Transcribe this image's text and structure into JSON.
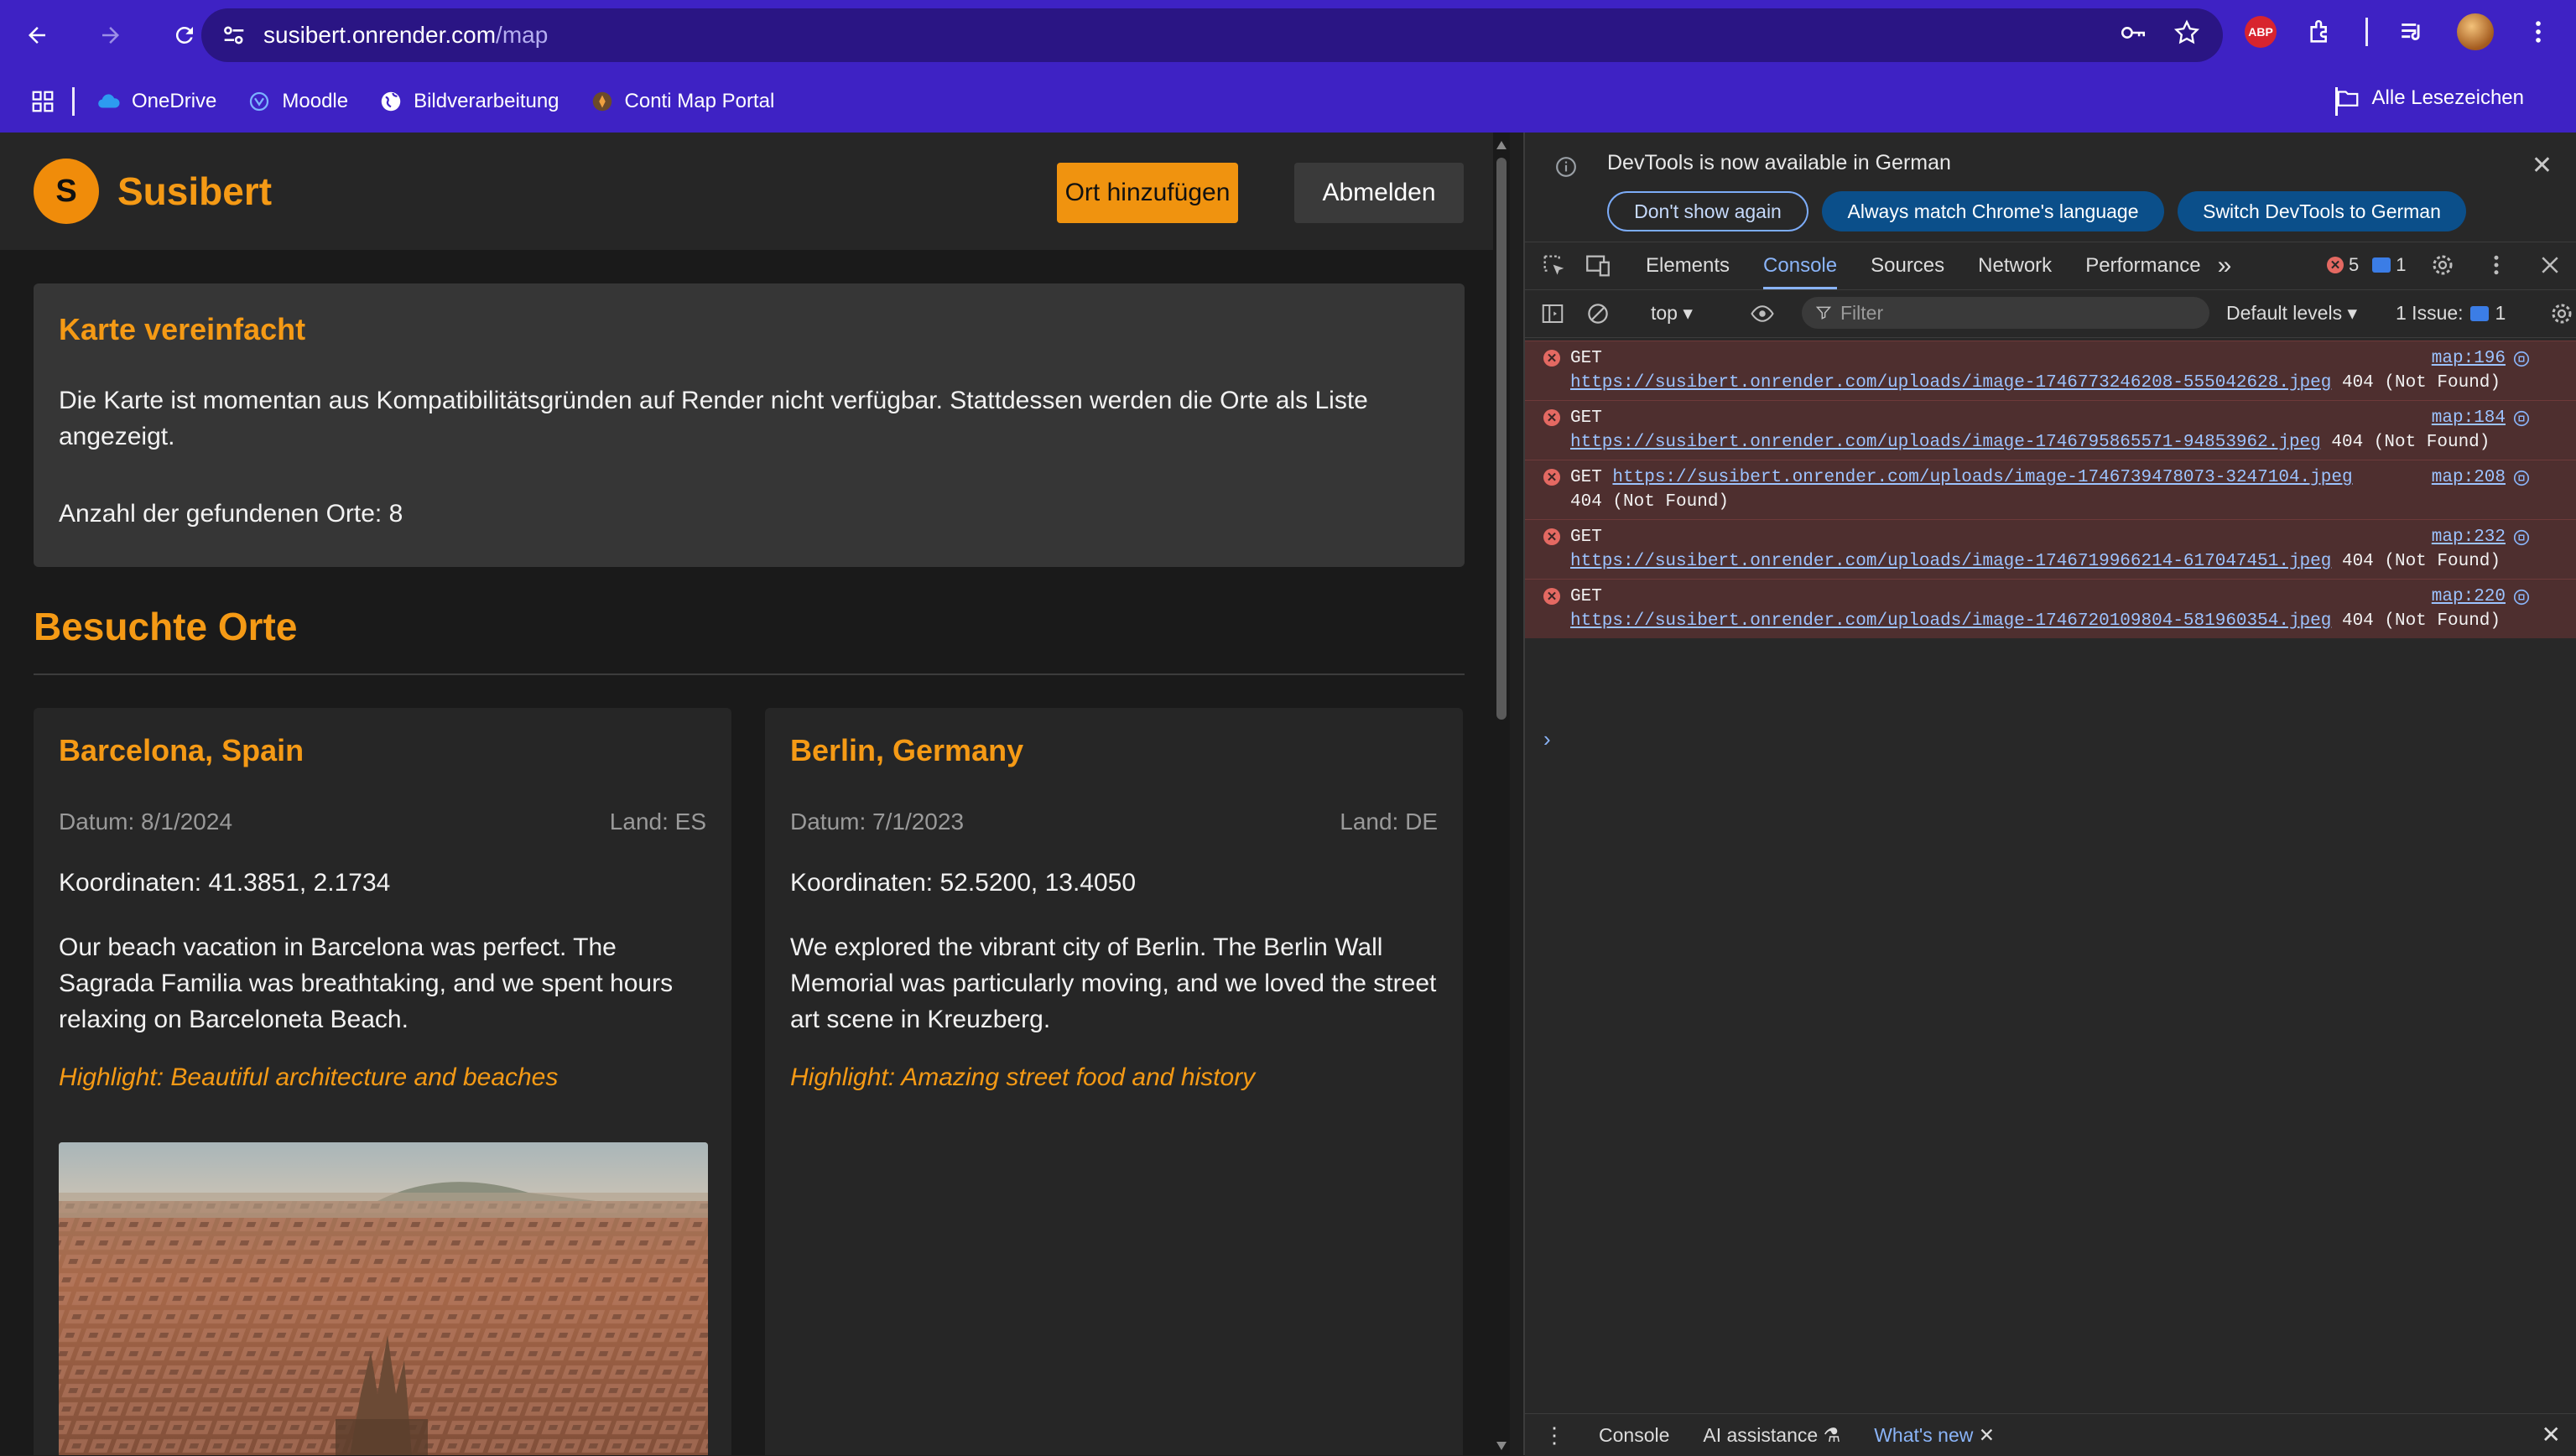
{
  "browser": {
    "url_host": "susibert.onrender.com",
    "url_path": "/map",
    "bookmarks": [
      {
        "label": "OneDrive"
      },
      {
        "label": "Moodle"
      },
      {
        "label": "Bildverarbeitung"
      },
      {
        "label": "Conti Map Portal"
      }
    ],
    "all_bookmarks": "Alle Lesezeichen",
    "abp_label": "ABP"
  },
  "app": {
    "logo_letter": "S",
    "brand": "Susibert",
    "add_button": "Ort hinzufügen",
    "logout_button": "Abmelden",
    "notice": {
      "title": "Karte vereinfacht",
      "message": "Die Karte ist momentan aus Kompatibilitätsgründen auf Render nicht verfügbar. Stattdessen werden die Orte als Liste angezeigt.",
      "count": "Anzahl der gefundenen Orte: 8"
    },
    "section_title": "Besuchte Orte",
    "cards": [
      {
        "title": "Barcelona, Spain",
        "date": "Datum: 8/1/2024",
        "land": "Land: ES",
        "coords": "Koordinaten: 41.3851, 2.1734",
        "description": "Our beach vacation in Barcelona was perfect. The Sagrada Familia was breathtaking, and we spent hours relaxing on Barceloneta Beach.",
        "highlight": "Highlight: Beautiful architecture and beaches"
      },
      {
        "title": "Berlin, Germany",
        "date": "Datum: 7/1/2023",
        "land": "Land: DE",
        "coords": "Koordinaten: 52.5200, 13.4050",
        "description": "We explored the vibrant city of Berlin. The Berlin Wall Memorial was particularly moving, and we loved the street art scene in Kreuzberg.",
        "highlight": "Highlight: Amazing street food and history"
      }
    ]
  },
  "devtools": {
    "info_text": "DevTools is now available in German",
    "btn_dont_show": "Don't show again",
    "btn_match": "Always match Chrome's language",
    "btn_switch": "Switch DevTools to German",
    "tabs": [
      "Elements",
      "Console",
      "Sources",
      "Network",
      "Performance"
    ],
    "active_tab": "Console",
    "more_tabs": "»",
    "error_count": "5",
    "message_count": "1",
    "context": "top ▾",
    "filter_placeholder": "Filter",
    "levels": "Default levels ▾",
    "issues_label": "1 Issue:",
    "issues_count": "1",
    "errors": [
      {
        "method": "GET",
        "url": "https://susibert.onrender.com/uploads/image-1746773246208-555042628.jpeg",
        "status": "404 (Not Found)",
        "source": "map:196"
      },
      {
        "method": "GET",
        "url": "https://susibert.onrender.com/uploads/image-1746795865571-94853962.jpeg",
        "status": "404 (Not Found)",
        "source": "map:184"
      },
      {
        "method": "GET",
        "url": "https://susibert.onrender.com/uploads/image-1746739478073-3247104.jpeg",
        "status": "404 (Not Found)",
        "source": "map:208"
      },
      {
        "method": "GET",
        "url": "https://susibert.onrender.com/uploads/image-1746719966214-617047451.jpeg",
        "status": "404 (Not Found)",
        "source": "map:232"
      },
      {
        "method": "GET",
        "url": "https://susibert.onrender.com/uploads/image-1746720109804-581960354.jpeg",
        "status": "404 (Not Found)",
        "source": "map:220"
      }
    ],
    "prompt": "›",
    "bottom": {
      "console": "Console",
      "ai": "AI assistance",
      "whatsnew": "What's new"
    }
  },
  "colors": {
    "chrome": "#3e22c4",
    "accent": "#f59a15",
    "button": "#f0930f",
    "error_bg": "#4e2f2f"
  }
}
